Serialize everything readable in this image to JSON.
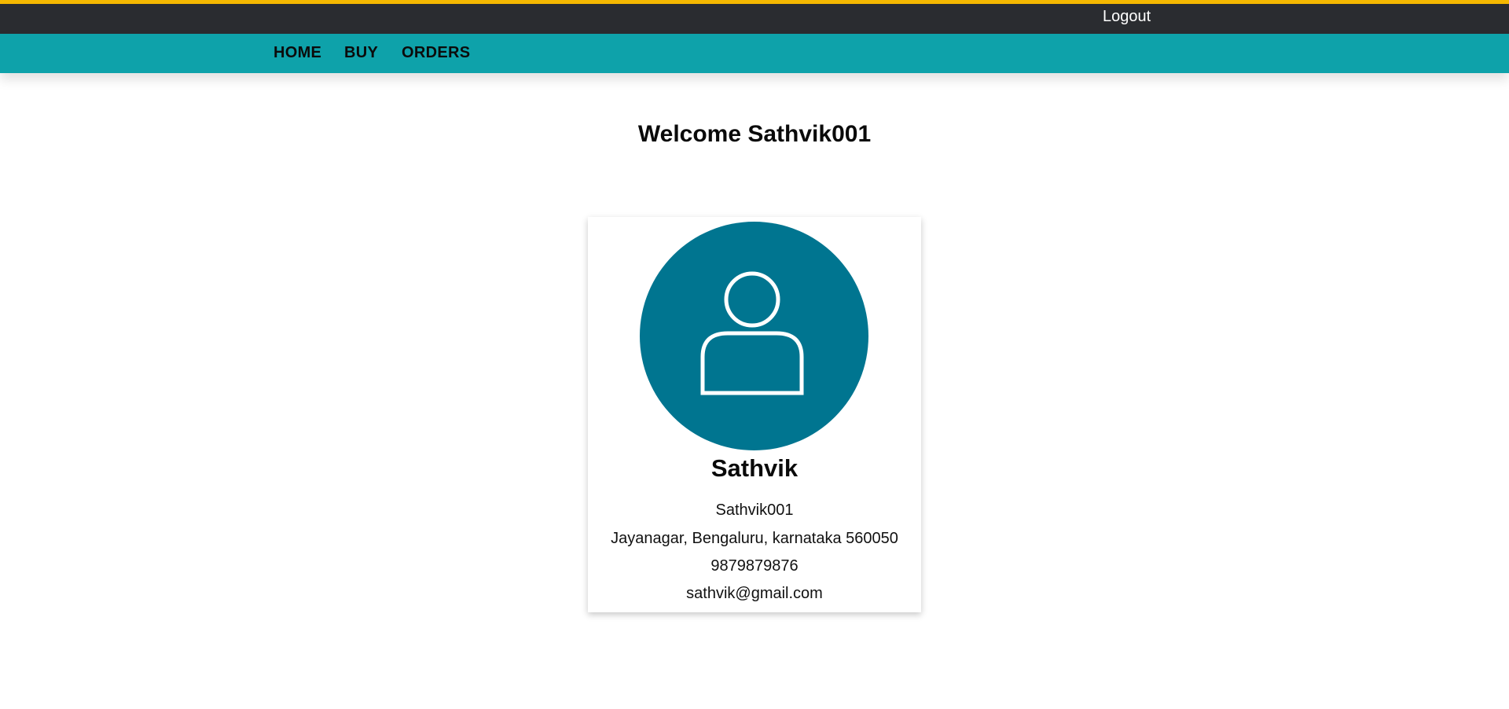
{
  "header": {
    "logout_label": "Logout",
    "accent_color": "#f5b800",
    "background_color": "#2a2c30"
  },
  "nav": {
    "background_color": "#0ea2aa",
    "items": [
      {
        "label": "HOME"
      },
      {
        "label": "BUY"
      },
      {
        "label": "ORDERS"
      }
    ]
  },
  "main": {
    "welcome_text": "Welcome Sathvik001"
  },
  "profile": {
    "avatar_icon": "user-icon",
    "avatar_color": "#007590",
    "name": "Sathvik",
    "username": "Sathvik001",
    "address": "Jayanagar, Bengaluru, karnataka 560050",
    "phone": "9879879876",
    "email": "sathvik@gmail.com"
  }
}
